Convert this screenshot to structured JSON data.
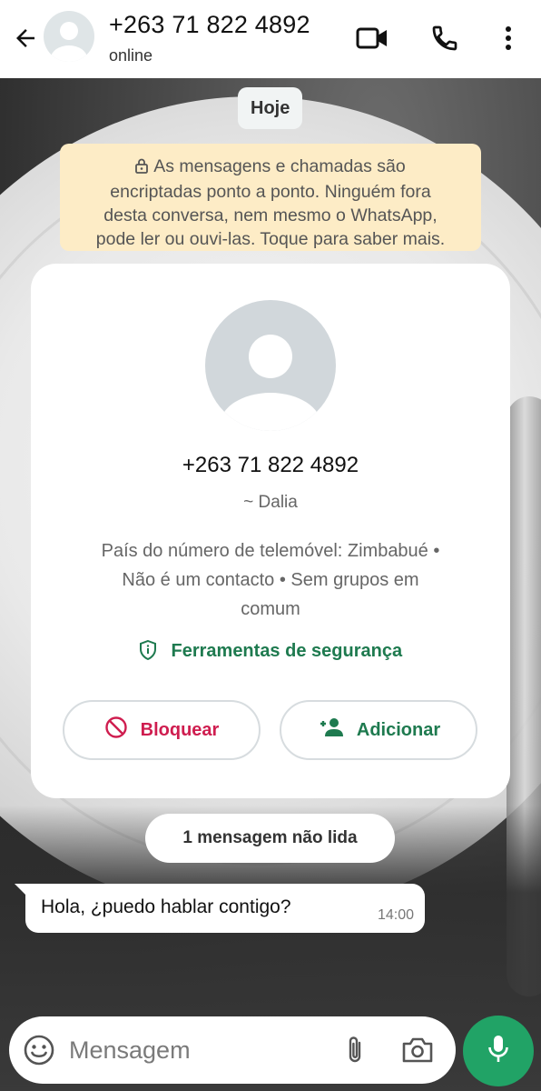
{
  "header": {
    "title": "+263 71 822 4892",
    "status": "online",
    "icons": [
      "back-arrow-icon",
      "video-call-icon",
      "voice-call-icon",
      "more-options-icon"
    ]
  },
  "chat": {
    "date_chip": "Hoje",
    "encryption_notice": {
      "icon": "lock-icon",
      "lines": [
        "As mensagens e chamadas são",
        "encriptadas ponto a ponto. Ninguém fora",
        "desta conversa, nem mesmo o WhatsApp,",
        "pode ler ou ouvi-las. Toque para saber mais."
      ]
    },
    "contact_card": {
      "phone": "+263 71 822 4892",
      "name": "~ Dalia",
      "info_lines": [
        "País do número de telemóvel: Zimbabué •",
        "Não é um contacto • Sem grupos em",
        "comum"
      ],
      "safety_tools_label": "Ferramentas de segurança",
      "block_label": "Bloquear",
      "add_label": "Adicionar"
    },
    "unread_chip": "1 mensagem não lida",
    "messages": [
      {
        "text": "Hola, ¿puedo hablar contigo?",
        "time": "14:00",
        "direction": "incoming"
      }
    ]
  },
  "composer": {
    "placeholder": "Mensagem"
  },
  "colors": {
    "accent_green": "#1e7a4f",
    "mic_green": "#21a366",
    "block_red": "#cf1d4f",
    "notice_bg": "#fdecc6"
  }
}
